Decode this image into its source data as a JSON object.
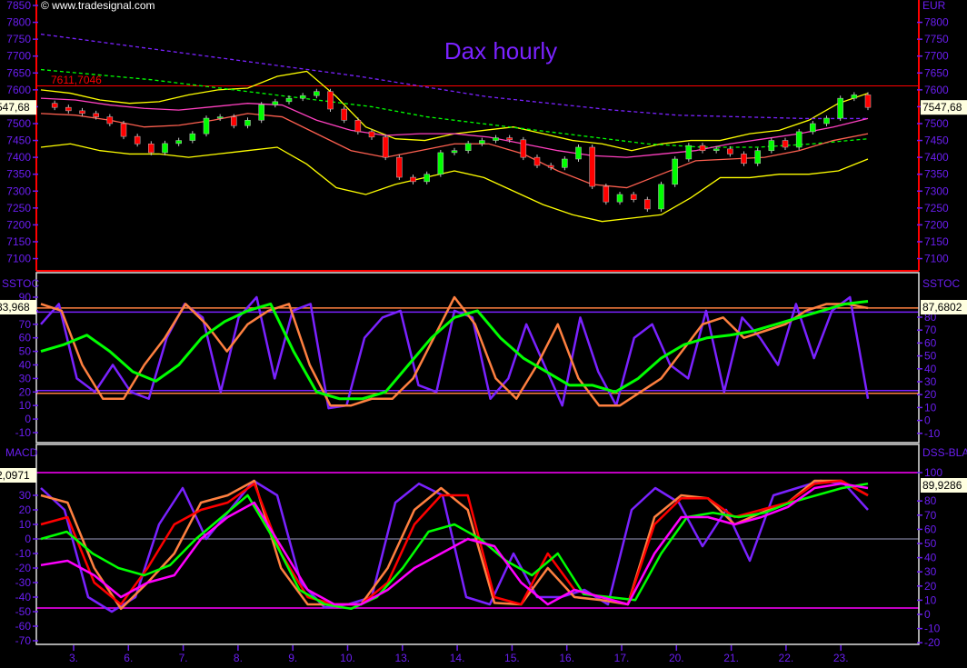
{
  "header": {
    "copyright": "© www.tradesignal.com",
    "title": "Dax hourly",
    "currency": "EUR"
  },
  "colors": {
    "background": "#000000",
    "axis_text": "#6a1ef0",
    "bull_candle": "#00ff00",
    "bear_candle": "#ff0000"
  },
  "chart_data": [
    {
      "type": "candlestick",
      "panel": "price",
      "title": "Dax hourly",
      "y_unit": "EUR",
      "ylim": [
        7075,
        7860
      ],
      "left_ticks": [
        7850,
        7800,
        7750,
        7700,
        7650,
        7600,
        7550,
        7500,
        7450,
        7400,
        7350,
        7300,
        7250,
        7200,
        7150,
        7100
      ],
      "right_ticks": [
        7800,
        7750,
        7700,
        7650,
        7600,
        7550,
        7500,
        7450,
        7400,
        7350,
        7300,
        7250,
        7200,
        7150,
        7100
      ],
      "last_value_left": "547,68",
      "last_value_right": "7547,68",
      "reference_line": {
        "value": 7611.7046,
        "label": "7611,7046",
        "color": "#ff0000"
      },
      "closes": [
        7560,
        7548,
        7538,
        7530,
        7520,
        7500,
        7462,
        7440,
        7414,
        7441,
        7450,
        7470,
        7516,
        7520,
        7494,
        7510,
        7556,
        7565,
        7575,
        7583,
        7595,
        7543,
        7510,
        7476,
        7460,
        7400,
        7341,
        7328,
        7350,
        7414,
        7420,
        7441,
        7450,
        7458,
        7452,
        7400,
        7376,
        7370,
        7395,
        7430,
        7314,
        7268,
        7290,
        7275,
        7247,
        7320,
        7395,
        7435,
        7420,
        7425,
        7410,
        7382,
        7420,
        7450,
        7430,
        7476,
        7500,
        7516,
        7575,
        7585,
        7548
      ],
      "overlays": [
        {
          "color": "#ffff00",
          "style": "solid",
          "values": [
            7600,
            7590,
            7570,
            7560,
            7565,
            7585,
            7600,
            7605,
            7640,
            7655,
            7580,
            7490,
            7455,
            7450,
            7470,
            7480,
            7490,
            7470,
            7450,
            7440,
            7420,
            7440,
            7450,
            7450,
            7470,
            7480,
            7510,
            7560,
            7590
          ]
        },
        {
          "color": "#ffff00",
          "style": "solid",
          "values": [
            7430,
            7440,
            7420,
            7410,
            7410,
            7400,
            7410,
            7420,
            7430,
            7380,
            7310,
            7290,
            7320,
            7340,
            7360,
            7340,
            7300,
            7260,
            7230,
            7210,
            7220,
            7230,
            7280,
            7340,
            7340,
            7350,
            7350,
            7360,
            7395
          ]
        },
        {
          "color": "#7a22ff",
          "style": "dashed",
          "values": [
            7765,
            7740,
            7715,
            7690,
            7665,
            7640,
            7610,
            7580,
            7560,
            7540,
            7525,
            7520,
            7515,
            7515
          ]
        },
        {
          "color": "#00ff00",
          "style": "dashed",
          "values": [
            7660,
            7645,
            7630,
            7610,
            7590,
            7570,
            7550,
            7520,
            7500,
            7480,
            7460,
            7440,
            7430,
            7430,
            7440,
            7455
          ]
        },
        {
          "color": "#ff40c0",
          "style": "solid",
          "values": [
            7575,
            7570,
            7555,
            7545,
            7540,
            7550,
            7560,
            7555,
            7510,
            7480,
            7465,
            7470,
            7470,
            7460,
            7440,
            7420,
            7405,
            7400,
            7410,
            7420,
            7440,
            7455,
            7470,
            7490,
            7515
          ]
        },
        {
          "color": "#ff6050",
          "style": "solid",
          "values": [
            7530,
            7525,
            7510,
            7490,
            7495,
            7510,
            7530,
            7520,
            7470,
            7420,
            7400,
            7420,
            7440,
            7440,
            7410,
            7360,
            7320,
            7310,
            7350,
            7390,
            7395,
            7400,
            7420,
            7450,
            7470
          ]
        }
      ]
    },
    {
      "type": "line",
      "panel": "SSTOC",
      "label_left": "SSTOC",
      "label_right": "SSTOC",
      "left_ticks": [
        90,
        80,
        70,
        60,
        50,
        40,
        30,
        20,
        10,
        0,
        -10
      ],
      "right_ticks": [
        80,
        70,
        60,
        50,
        40,
        30,
        20,
        10,
        0,
        -10
      ],
      "last_value_left": "83,968",
      "last_value_right": "87,6802",
      "levels": [
        {
          "value": 82,
          "color": "#ff8040"
        },
        {
          "value": 79,
          "color": "#7a22ff"
        },
        {
          "value": 21,
          "color": "#7a22ff"
        },
        {
          "value": 19,
          "color": "#ff8040"
        }
      ],
      "series": [
        {
          "color": "#7a22ff",
          "width": 2.5,
          "values": [
            70,
            85,
            30,
            20,
            40,
            20,
            15,
            60,
            85,
            75,
            20,
            75,
            90,
            30,
            80,
            85,
            8,
            10,
            60,
            75,
            80,
            25,
            20,
            80,
            75,
            15,
            30,
            70,
            40,
            10,
            75,
            35,
            10,
            60,
            70,
            40,
            30,
            80,
            20,
            75,
            60,
            40,
            85,
            45,
            80,
            90,
            15
          ]
        },
        {
          "color": "#ff8040",
          "width": 2.5,
          "values": [
            85,
            80,
            40,
            15,
            15,
            40,
            60,
            85,
            70,
            50,
            70,
            80,
            85,
            40,
            10,
            10,
            15,
            15,
            30,
            60,
            90,
            70,
            30,
            15,
            40,
            70,
            30,
            10,
            10,
            20,
            30,
            50,
            70,
            75,
            60,
            65,
            70,
            80,
            85,
            85,
            82
          ]
        },
        {
          "color": "#00ff00",
          "width": 3,
          "values": [
            50,
            55,
            62,
            50,
            35,
            28,
            40,
            60,
            72,
            80,
            85,
            50,
            20,
            15,
            15,
            20,
            40,
            60,
            75,
            80,
            60,
            45,
            35,
            25,
            25,
            20,
            30,
            45,
            55,
            60,
            62,
            65,
            70,
            75,
            80,
            85,
            87
          ]
        }
      ]
    },
    {
      "type": "line",
      "panel": "MACD / DSS-BLAU",
      "label_left": "MACD",
      "label_right": "DSS-BLAU",
      "left_ticks": [
        30,
        20,
        10,
        0,
        -10,
        -20,
        -30,
        -40,
        -50,
        -60,
        -70
      ],
      "right_ticks": [
        100,
        80,
        70,
        60,
        50,
        40,
        30,
        20,
        10,
        0,
        -10,
        -20
      ],
      "last_value_left": "2,0971",
      "last_value_right": "89,9286",
      "series": [
        {
          "color": "#7a22ff",
          "width": 2.5,
          "values": [
            35,
            20,
            -40,
            -50,
            -40,
            10,
            35,
            0,
            20,
            40,
            30,
            -30,
            -47,
            -45,
            -40,
            25,
            38,
            30,
            -40,
            -45,
            -10,
            -40,
            -40,
            -35,
            -45,
            20,
            35,
            25,
            -5,
            20,
            -15,
            30,
            35,
            40,
            38,
            20
          ]
        },
        {
          "color": "#ff8040",
          "width": 2.5,
          "values": [
            30,
            25,
            -20,
            -48,
            -30,
            -10,
            25,
            30,
            40,
            -20,
            -45,
            -45,
            -45,
            -20,
            20,
            35,
            20,
            -44,
            -45,
            -20,
            -40,
            -42,
            -45,
            15,
            30,
            28,
            10,
            18,
            25,
            40,
            40,
            30
          ]
        },
        {
          "color": "#ff0000",
          "width": 2.5,
          "values": [
            10,
            15,
            -30,
            -45,
            -20,
            10,
            20,
            25,
            38,
            -10,
            -40,
            -45,
            -45,
            -30,
            10,
            30,
            30,
            -40,
            -45,
            -10,
            -35,
            -40,
            -45,
            10,
            28,
            28,
            15,
            20,
            25,
            38,
            40,
            30
          ]
        },
        {
          "color": "#00ff00",
          "width": 2.5,
          "values": [
            0,
            5,
            -10,
            -20,
            -25,
            -18,
            0,
            15,
            30,
            0,
            -35,
            -45,
            -48,
            -40,
            -20,
            5,
            10,
            0,
            -15,
            -25,
            -10,
            -38,
            -40,
            -42,
            -10,
            15,
            18,
            15,
            18,
            25,
            30,
            35,
            38
          ]
        },
        {
          "color": "#ff00ff",
          "width": 2.5,
          "values": [
            -18,
            -15,
            -25,
            -40,
            -30,
            -25,
            0,
            15,
            25,
            -5,
            -35,
            -45,
            -45,
            -35,
            -20,
            -10,
            0,
            -5,
            -30,
            -45,
            -35,
            -40,
            -45,
            -10,
            15,
            15,
            10,
            15,
            22,
            35,
            38,
            35
          ]
        }
      ]
    }
  ],
  "x_axis": {
    "tick_labels": [
      "3.",
      "6.",
      "7.",
      "8.",
      "9.",
      "10.",
      "13.",
      "14.",
      "15.",
      "16.",
      "17.",
      "20.",
      "21.",
      "22.",
      "23."
    ]
  }
}
